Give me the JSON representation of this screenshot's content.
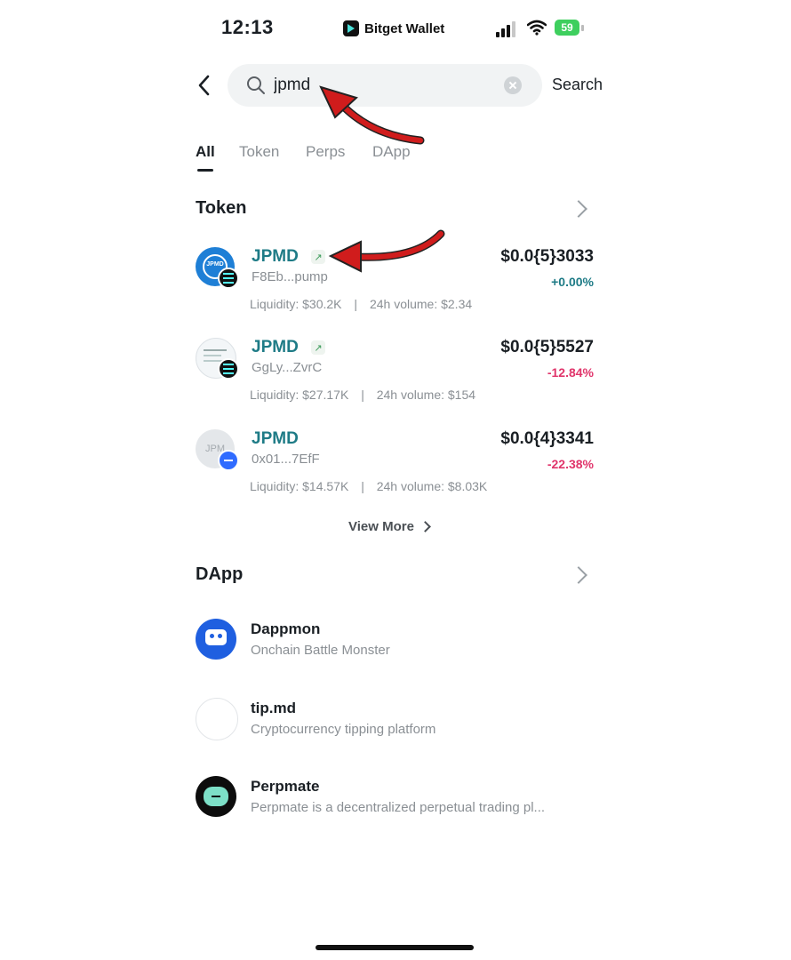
{
  "status_bar": {
    "time": "12:13",
    "app_name": "Bitget Wallet",
    "battery": "59"
  },
  "search": {
    "value": "jpmd",
    "placeholder": "",
    "button_label": "Search"
  },
  "tabs": [
    {
      "label": "All",
      "active": true
    },
    {
      "label": "Token",
      "active": false
    },
    {
      "label": "Perps",
      "active": false
    },
    {
      "label": "DApp",
      "active": false
    }
  ],
  "token_section": {
    "title": "Token",
    "items": [
      {
        "name": "JPMD",
        "address": "F8Eb...pump",
        "price": "$0.0{5}3033",
        "change": "+0.00%",
        "change_color": "#1e7b86",
        "liquidity": "Liquidity: $30.2K",
        "volume": "24h volume: $2.34",
        "verified": true,
        "icon_text": "JPMD"
      },
      {
        "name": "JPMD",
        "address": "GgLy...ZvrC",
        "price": "$0.0{5}5527",
        "change": "-12.84%",
        "change_color": "#e0356b",
        "liquidity": "Liquidity: $27.17K",
        "volume": "24h volume: $154",
        "verified": true
      },
      {
        "name": "JPMD",
        "address": "0x01...7EfF",
        "price": "$0.0{4}3341",
        "change": "-22.38%",
        "change_color": "#e0356b",
        "liquidity": "Liquidity: $14.57K",
        "volume": "24h volume: $8.03K",
        "verified": false,
        "icon_text": "JPM"
      }
    ],
    "view_more": "View More"
  },
  "dapp_section": {
    "title": "DApp",
    "items": [
      {
        "name": "Dappmon",
        "description": "Onchain Battle Monster"
      },
      {
        "name": "tip.md",
        "description": "Cryptocurrency tipping platform"
      },
      {
        "name": "Perpmate",
        "description": "Perpmate is a decentralized perpetual trading pl..."
      }
    ]
  },
  "colors": {
    "accent": "#1e7b86",
    "negative": "#e0356b",
    "annotation_arrow": "#d01c1c"
  }
}
